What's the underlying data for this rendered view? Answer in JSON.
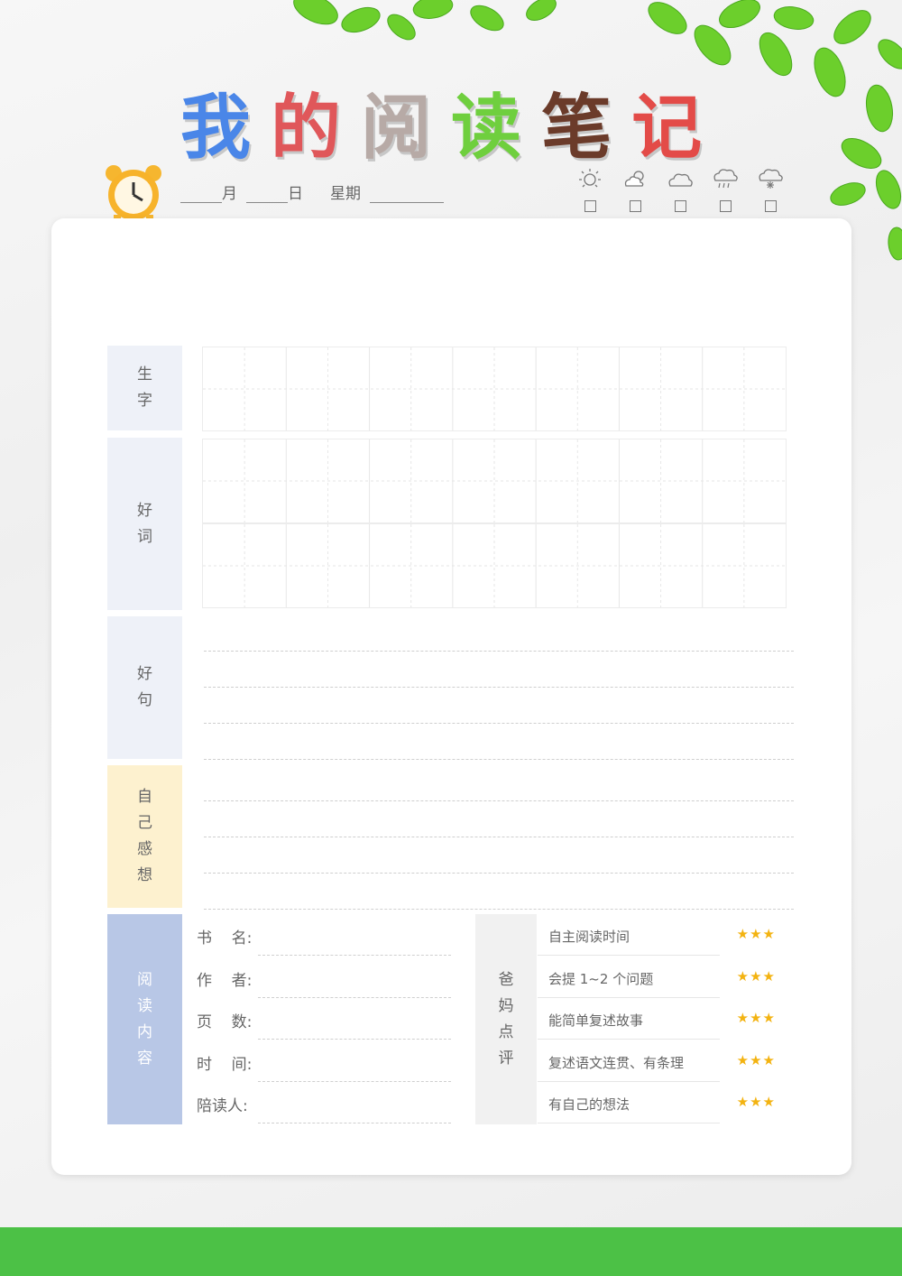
{
  "title": {
    "chars": [
      "我",
      "的",
      "阅",
      "读",
      "笔",
      "记"
    ],
    "colors": [
      "#4a86e8",
      "#e0575a",
      "#b7aaa6",
      "#6fcf3e",
      "#6b3b2a",
      "#e34b48"
    ]
  },
  "date": {
    "month": "月",
    "day": "日",
    "weekday": "星期"
  },
  "weather": [
    "sunny-icon",
    "partly-cloudy-icon",
    "cloudy-icon",
    "rain-icon",
    "snow-icon"
  ],
  "sections": {
    "new_chars": {
      "chars": [
        "生",
        "字"
      ],
      "color": "#eef1f8"
    },
    "good_words": {
      "chars": [
        "好",
        "词"
      ],
      "color": "#eef1f8"
    },
    "good_sentences": {
      "chars": [
        "好",
        "句"
      ],
      "color": "#eef1f8"
    },
    "feelings": {
      "chars": [
        "自",
        "己",
        "感",
        "想"
      ],
      "color": "#fdf1cf"
    },
    "reading": {
      "chars": [
        "阅",
        "读",
        "内",
        "容"
      ],
      "color": "#b8c7e6"
    }
  },
  "info_fields": [
    "书    名:",
    "作    者:",
    "页    数:",
    "时    间:",
    "陪读人:"
  ],
  "parent_review": {
    "chars": [
      "爸",
      "妈",
      "点",
      "评"
    ],
    "items": [
      {
        "text": "自主阅读时间",
        "stars": "★★★"
      },
      {
        "text": "会提 1~2 个问题",
        "stars": "★★★"
      },
      {
        "text": "能简单复述故事",
        "stars": "★★★"
      },
      {
        "text": "复述语文连贯、有条理",
        "stars": "★★★"
      },
      {
        "text": "有自己的想法",
        "stars": "★★★"
      }
    ]
  },
  "colors": {
    "bottom_bar": "#4cc146",
    "star": "#f3b311"
  }
}
